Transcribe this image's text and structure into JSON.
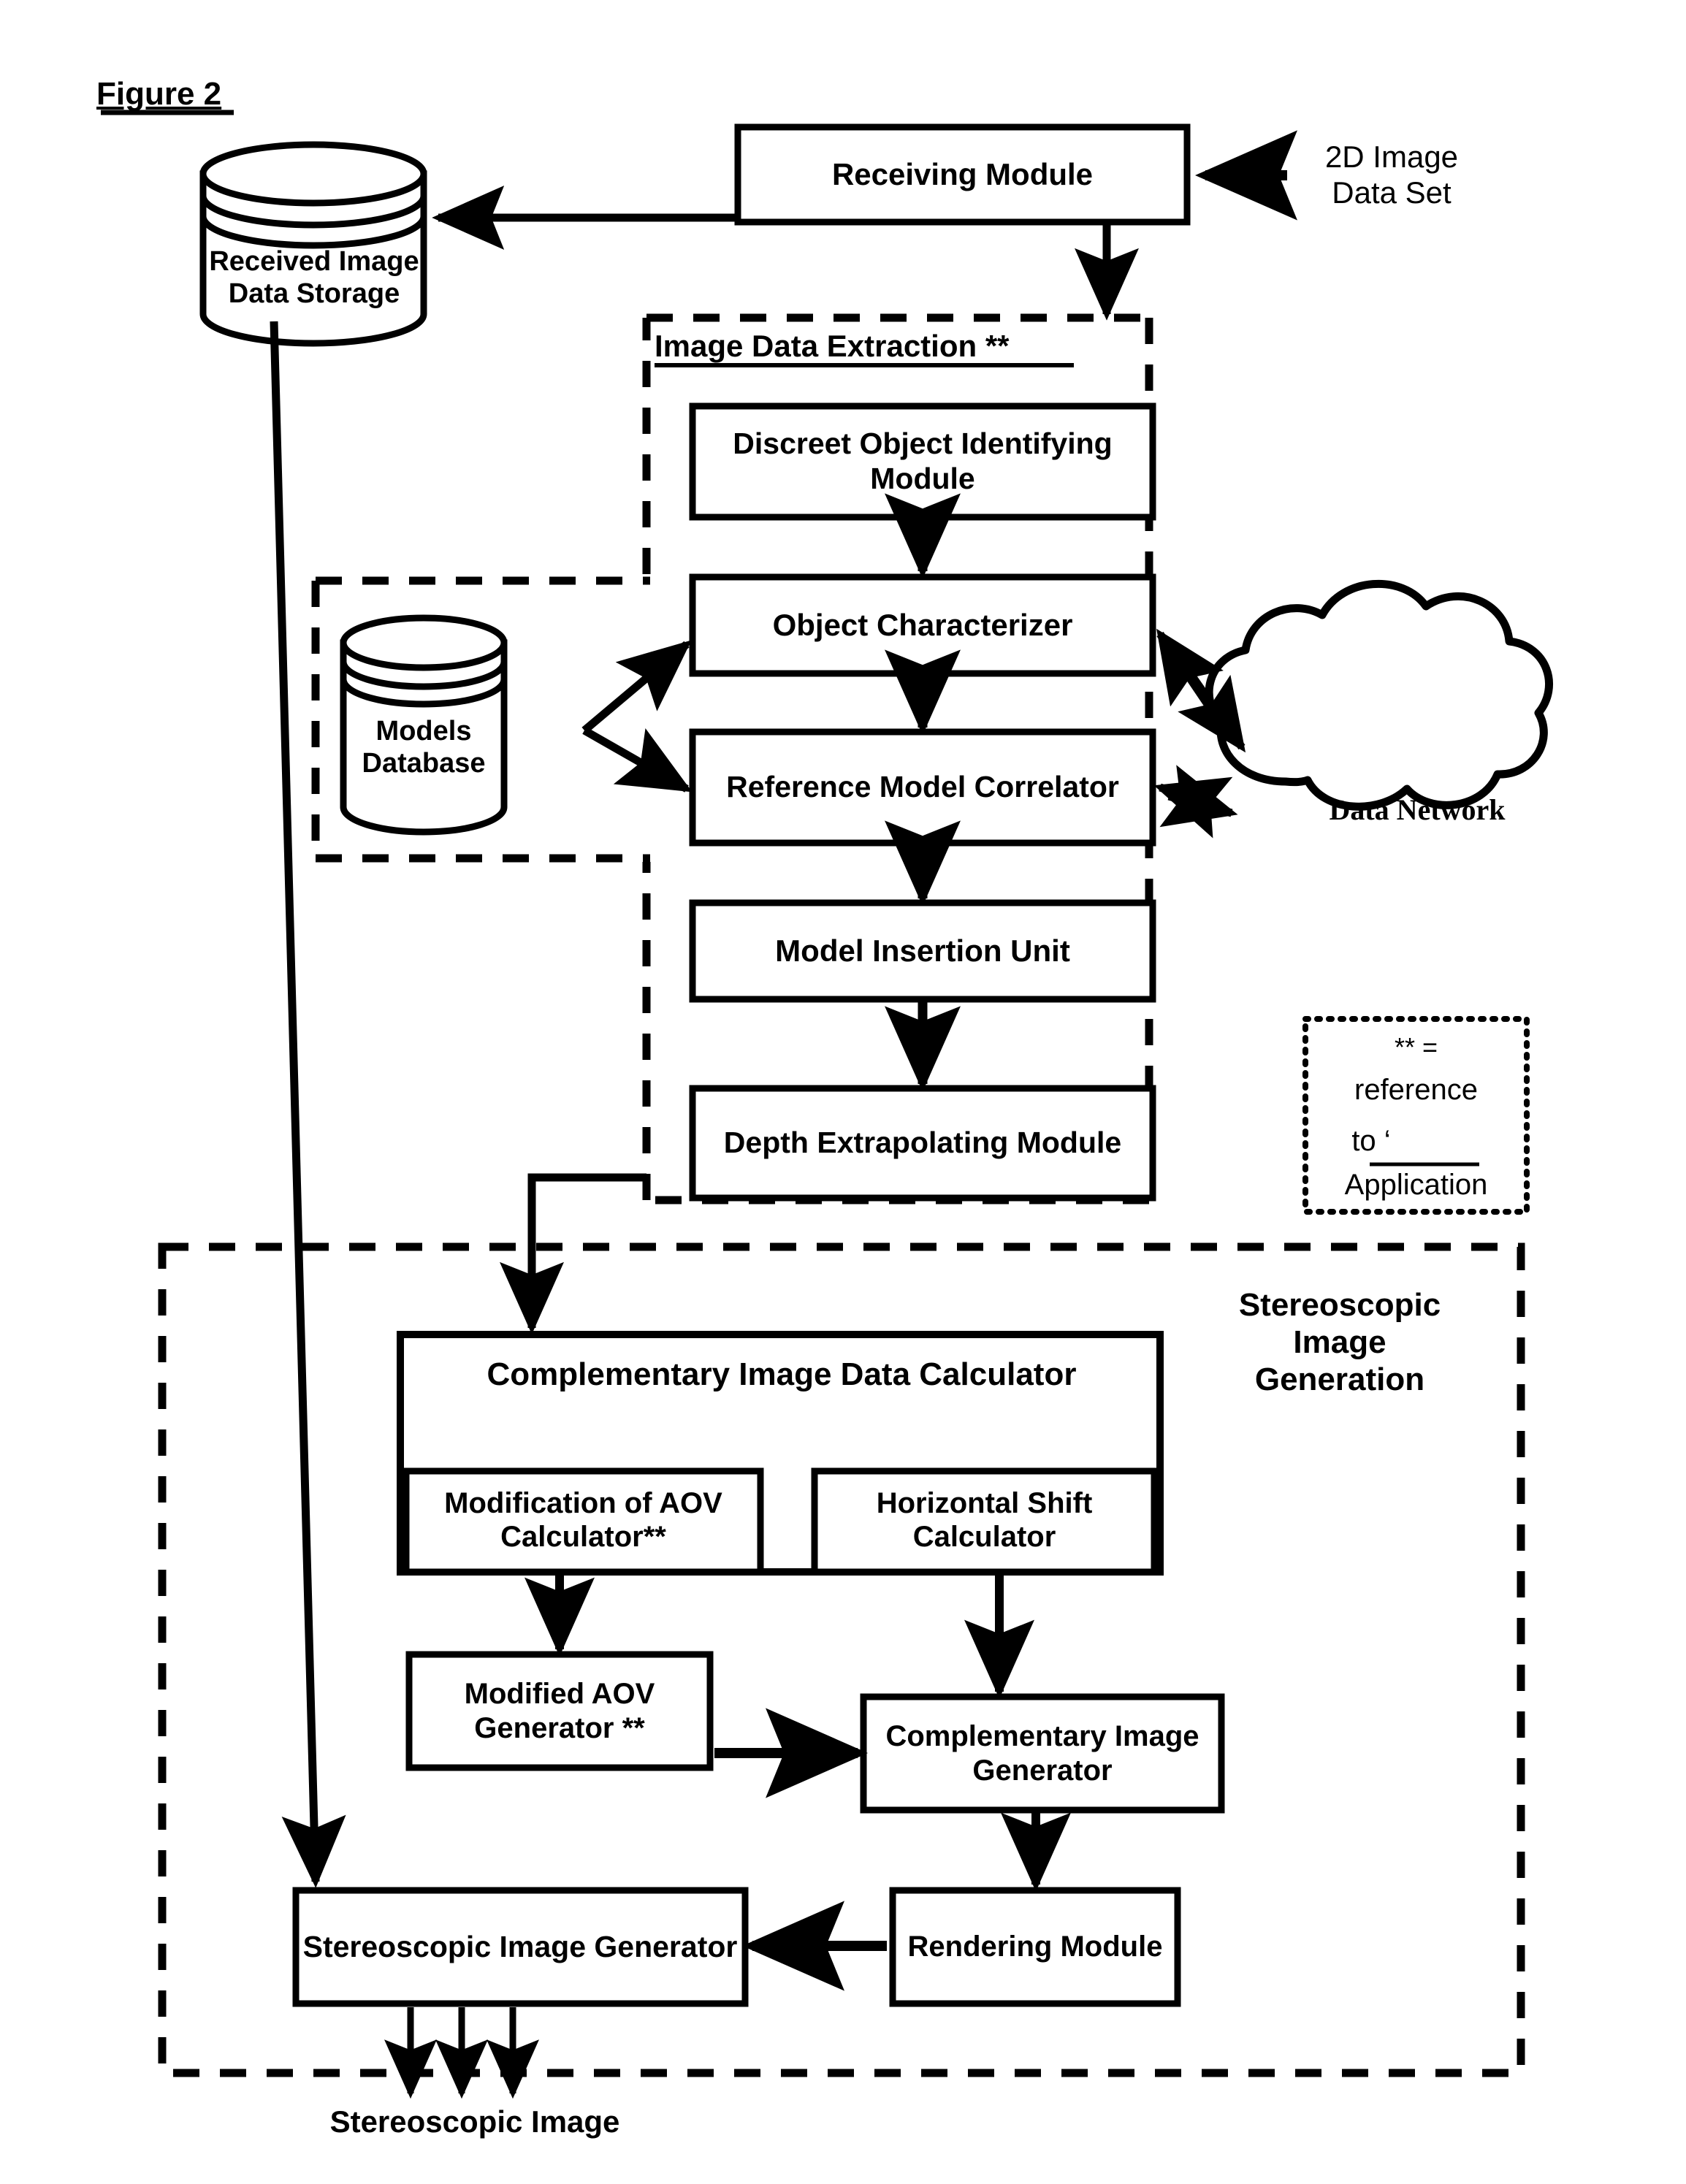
{
  "figure": {
    "title": "Figure 2"
  },
  "storage": {
    "received_image_data_storage": "Received Image Data Storage",
    "models_database": "Models Database"
  },
  "inputs": {
    "source_label": "2D Image Data Set"
  },
  "outputs": {
    "result_label": "Stereoscopic Image"
  },
  "network": {
    "cloud_label": "Data Network"
  },
  "groups": {
    "image_data_extraction": "Image Data Extraction **",
    "stereoscopic_image_generation": "Stereoscopic Image Generation"
  },
  "legend": {
    "line1": "** =",
    "line2": "reference",
    "line3": "to ‘",
    "line4": "Application"
  },
  "modules": {
    "receiving": "Receiving Module",
    "discreet_object_identifying": "Discreet Object Identifying Module",
    "object_characterizer": "Object Characterizer",
    "reference_model_correlator": "Reference Model Correlator",
    "model_insertion_unit": "Model Insertion Unit",
    "depth_extrapolating": "Depth Extrapolating Module",
    "complementary_image_data_calculator": "Complementary Image Data Calculator",
    "modification_of_aov_calculator": "Modification of AOV Calculator**",
    "horizontal_shift_calculator": "Horizontal Shift Calculator",
    "modified_aov_generator": "Modified AOV Generator **",
    "complementary_image_generator": "Complementary Image Generator",
    "rendering_module": "Rendering Module",
    "stereoscopic_image_generator": "Stereoscopic Image Generator"
  },
  "colors": {
    "ink": "#000000",
    "paper": "#ffffff"
  }
}
